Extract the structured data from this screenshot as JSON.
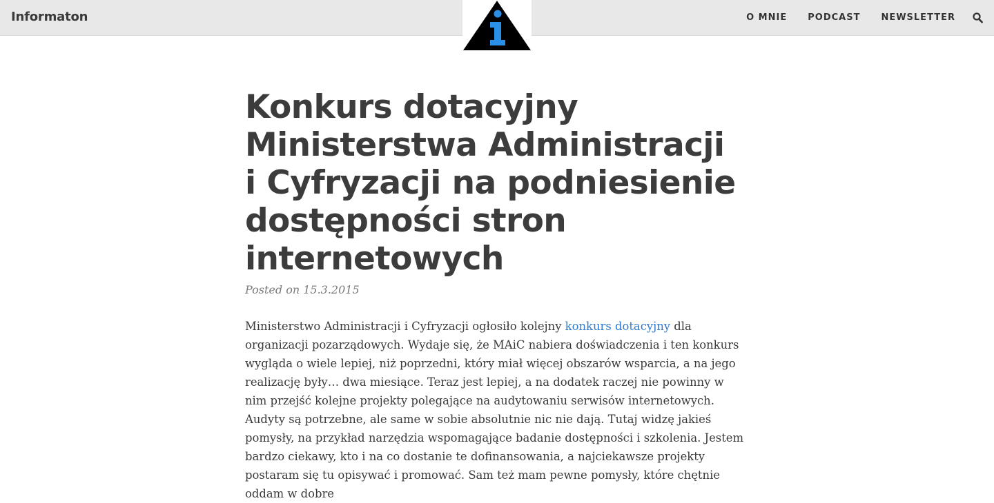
{
  "header": {
    "site_title": "Informaton",
    "nav": [
      {
        "label": "O MNIE"
      },
      {
        "label": "PODCAST"
      },
      {
        "label": "NEWSLETTER"
      }
    ],
    "colors": {
      "bar": "#e8e8e8",
      "logo_triangle": "#000000",
      "logo_glyph": "#2a8fe6"
    }
  },
  "article": {
    "title": "Konkurs dotacyjny Ministerstwa Administracji i Cyfryzacji na podniesienie dostępności stron internetowych",
    "meta": "Posted on 15.3.2015",
    "paragraph": {
      "before_link": "Ministerstwo Administracji i Cyfryzacji ogłosiło kolejny ",
      "link_text": "konkurs dotacyjny",
      "after_link": " dla organizacji pozarządowych. Wydaje się, że MAiC nabiera doświadczenia i ten konkurs wygląda o wiele lepiej, niż poprzedni, który miał więcej obszarów wsparcia, a na jego realizację były… dwa miesiące. Teraz jest lepiej, a na dodatek raczej nie powinny w nim przejść kolejne projekty polegające na audytowaniu serwisów internetowych. Audyty są potrzebne, ale same w sobie absolutnie nic nie dają. Tutaj widzę jakieś pomysły, na przykład narzędzia wspomagające badanie dostępności i szkolenia. Jestem bardzo ciekawy, kto i na co dostanie te dofinansowania, a najciekawsze projekty postaram się tu opisywać i promować. Sam też mam pewne pomysły, które chętnie oddam w dobre"
    },
    "link_color": "#2e7bcf"
  }
}
